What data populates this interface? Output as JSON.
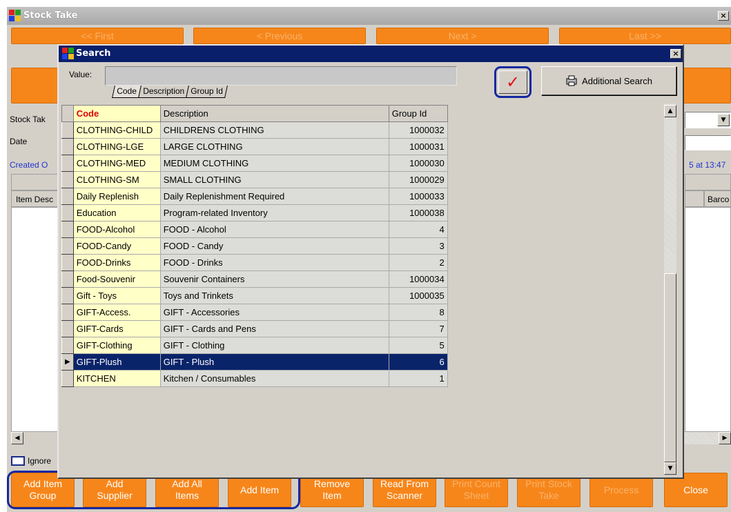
{
  "main": {
    "title": "Stock Take",
    "close_glyph": "×",
    "nav": {
      "first": "<< First",
      "previous": "< Previous",
      "next": "Next >",
      "last": "Last >>"
    },
    "labels": {
      "stock_take": "Stock Tak",
      "date": "Date",
      "created": "Created O",
      "created_right": "5 at 13:47",
      "item_desc": "Item Desc",
      "barcode": "Barco",
      "ignore": "Ignore"
    },
    "bottom_buttons": [
      {
        "l1": "Add Item",
        "l2": "Group"
      },
      {
        "l1": "Add",
        "l2": "Supplier"
      },
      {
        "l1": "Add All",
        "l2": "Items"
      },
      {
        "l1": "Add Item",
        "l2": ""
      },
      {
        "l1": "Remove",
        "l2": "Item"
      },
      {
        "l1": "Read From",
        "l2": "Scanner"
      },
      {
        "l1": "Print Count",
        "l2": "Sheet"
      },
      {
        "l1": "Print Stock",
        "l2": "Take"
      },
      {
        "l1": "Process",
        "l2": ""
      },
      {
        "l1": "Close",
        "l2": ""
      }
    ]
  },
  "dialog": {
    "title": "Search",
    "close_glyph": "×",
    "value_label": "Value:",
    "value": "",
    "tabs": [
      "Code",
      "Description",
      "Group Id"
    ],
    "ok_glyph": "✓",
    "additional_search": "Additional Search",
    "columns": {
      "code": "Code",
      "description": "Description",
      "group_id": "Group Id"
    },
    "rows": [
      {
        "code": "CLOTHING-CHILD",
        "description": "CHILDRENS CLOTHING",
        "group_id": "1000032"
      },
      {
        "code": "CLOTHING-LGE",
        "description": "LARGE CLOTHING",
        "group_id": "1000031"
      },
      {
        "code": "CLOTHING-MED",
        "description": "MEDIUM CLOTHING",
        "group_id": "1000030"
      },
      {
        "code": "CLOTHING-SM",
        "description": "SMALL CLOTHING",
        "group_id": "1000029"
      },
      {
        "code": "Daily Replenish",
        "description": "Daily Replenishment Required",
        "group_id": "1000033"
      },
      {
        "code": "Education",
        "description": "Program-related Inventory",
        "group_id": "1000038"
      },
      {
        "code": "FOOD-Alcohol",
        "description": "FOOD - Alcohol",
        "group_id": "4"
      },
      {
        "code": "FOOD-Candy",
        "description": "FOOD - Candy",
        "group_id": "3"
      },
      {
        "code": "FOOD-Drinks",
        "description": "FOOD - Drinks",
        "group_id": "2"
      },
      {
        "code": "Food-Souvenir",
        "description": "Souvenir Containers",
        "group_id": "1000034"
      },
      {
        "code": "Gift - Toys",
        "description": "Toys and Trinkets",
        "group_id": "1000035"
      },
      {
        "code": "GIFT-Access.",
        "description": "GIFT - Accessories",
        "group_id": "8"
      },
      {
        "code": "GIFT-Cards",
        "description": "GIFT - Cards and Pens",
        "group_id": "7"
      },
      {
        "code": "GIFT-Clothing",
        "description": "GIFT - Clothing",
        "group_id": "5"
      },
      {
        "code": "GIFT-Plush",
        "description": "GIFT - Plush",
        "group_id": "6",
        "selected": true
      },
      {
        "code": "KITCHEN",
        "description": "Kitchen / Consumables",
        "group_id": "1"
      }
    ],
    "row_indicator": "▶"
  },
  "colors": {
    "accent_orange": "#f7861a",
    "dialog_title": "#0a1f6b",
    "selection": "#0a246a",
    "highlight_outline": "#1428a0",
    "check_red": "#e0101a"
  }
}
